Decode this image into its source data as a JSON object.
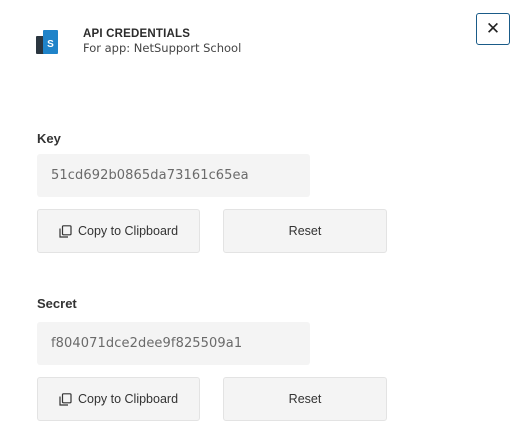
{
  "header": {
    "title": "API CREDENTIALS",
    "subtitle": "For app: NetSupport School",
    "logo_letter": "S"
  },
  "close_button": {
    "label": "✕"
  },
  "key_section": {
    "label": "Key",
    "value": "51cd692b0865da73161c65ea",
    "copy_label": "Copy to Clipboard",
    "reset_label": "Reset"
  },
  "secret_section": {
    "label": "Secret",
    "value": "f804071dce2dee9f825509a1",
    "copy_label": "Copy to Clipboard",
    "reset_label": "Reset"
  },
  "colors": {
    "logo_blue": "#1f83c9",
    "logo_dark": "#2b3640",
    "close_border": "#1a5b88",
    "field_background": "#f4f4f4"
  },
  "icons": {
    "close": "close-icon",
    "copy": "copy-icon",
    "logo": "app-logo"
  }
}
